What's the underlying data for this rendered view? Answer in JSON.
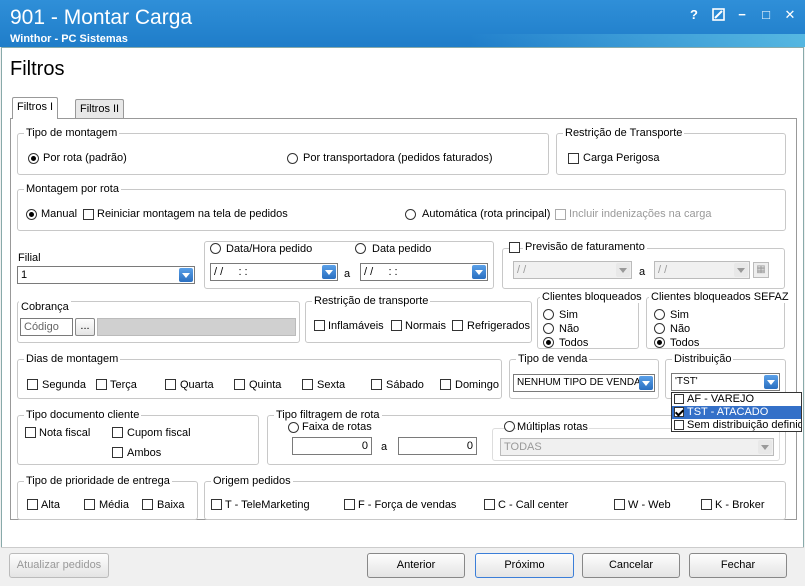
{
  "window": {
    "title": "901 - Montar Carga",
    "subtitle": "Winthor - PC Sistemas",
    "help_icon": "?",
    "edit_icon": "edit-icon",
    "minimize_icon": "−",
    "maximize_icon": "□",
    "close_icon": "✕"
  },
  "page_title": "Filtros",
  "tabs": [
    {
      "label": "Filtros I",
      "active": true
    },
    {
      "label": "Filtros II",
      "active": false
    }
  ],
  "tipo_montagem": {
    "label": "Tipo de montagem",
    "opt_rota": "Por rota (padrão)",
    "opt_transportadora": "Por transportadora (pedidos faturados)"
  },
  "restricao_transporte_top": {
    "label": "Restrição de Transporte",
    "carga_perigosa": "Carga Perigosa"
  },
  "montagem_rota": {
    "label": "Montagem por rota",
    "manual": "Manual",
    "reiniciar": "Reiniciar montagem na tela de pedidos",
    "automatica": "Automática (rota principal)",
    "incluir": "Incluir indenizações na carga"
  },
  "filial": {
    "label": "Filial",
    "value": "1"
  },
  "datas": {
    "data_hora_label": "Data/Hora pedido",
    "data_pedido_label": "Data pedido",
    "from_value": "/ /     : :",
    "to_value": "/ /     : :",
    "separator": "a"
  },
  "previsao": {
    "label": "Previsão de faturamento",
    "from_value": "/ /",
    "to_value": "/ /",
    "separator": "a"
  },
  "cobranca": {
    "label": "Cobrança",
    "placeholder": "Código",
    "btn_label": "...",
    "desc_value": ""
  },
  "restricao_transporte": {
    "label": "Restrição de transporte",
    "inflamaveis": "Inflamáveis",
    "normais": "Normais",
    "refrigerados": "Refrigerados"
  },
  "clientes_bloqueados": {
    "label": "Clientes bloqueados",
    "sim": "Sim",
    "nao": "Não",
    "todos": "Todos"
  },
  "clientes_bloqueados_sefaz": {
    "label": "Clientes bloqueados SEFAZ",
    "sim": "Sim",
    "nao": "Não",
    "todos": "Todos"
  },
  "dias_montagem": {
    "label": "Dias de montagem",
    "days": [
      "Segunda",
      "Terça",
      "Quarta",
      "Quinta",
      "Sexta",
      "Sábado",
      "Domingo"
    ]
  },
  "tipo_venda": {
    "label": "Tipo de venda",
    "value": "NENHUM TIPO DE VENDA"
  },
  "distribuicao": {
    "label": "Distribuição",
    "value": "'TST'",
    "options": [
      {
        "label": "AF - VAREJO",
        "checked": false
      },
      {
        "label": "TST - ATACADO",
        "checked": true
      },
      {
        "label": "Sem distribuição definida",
        "checked": false
      }
    ]
  },
  "tipo_documento": {
    "label": "Tipo documento cliente",
    "nota_fiscal": "Nota fiscal",
    "cupom_fiscal": "Cupom fiscal",
    "ambos": "Ambos"
  },
  "tipo_filtragem": {
    "label": "Tipo filtragem de rota",
    "faixa": "Faixa de rotas",
    "from_value": "0",
    "to_value": "0",
    "separator": "a",
    "multiplas": "Múltiplas rotas",
    "multiplas_value": "TODAS"
  },
  "prioridade": {
    "label": "Tipo de prioridade de  entrega",
    "alta": "Alta",
    "media": "Média",
    "baixa": "Baixa"
  },
  "origem": {
    "label": "Origem pedidos",
    "items": [
      "T - TeleMarketing",
      "F - Força de vendas",
      "C - Call center",
      "W - Web",
      "K - Broker"
    ]
  },
  "buttons": {
    "atualizar": "Atualizar pedidos",
    "anterior": "Anterior",
    "proximo": "Próximo",
    "cancelar": "Cancelar",
    "fechar": "Fechar"
  }
}
